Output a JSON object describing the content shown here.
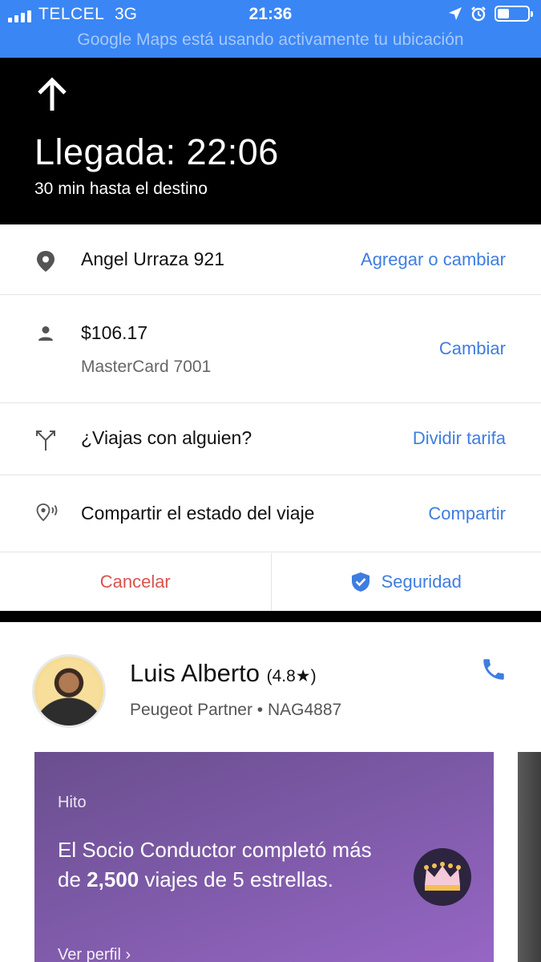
{
  "status_bar": {
    "carrier": "TELCEL",
    "network": "3G",
    "time": "21:36",
    "battery_level": 0.3,
    "banner": "Google Maps está usando activamente tu ubicación",
    "icons": [
      "location-arrow-icon",
      "alarm-icon",
      "battery-icon"
    ],
    "accent_color": "#3a86f5"
  },
  "navigation": {
    "direction_icon": "arrow-up-icon",
    "arrival": "Llegada: 22:06",
    "eta": "30 min hasta el destino"
  },
  "trip_rows": {
    "destination": {
      "icon": "map-pin-icon",
      "text": "Angel Urraza 921",
      "action": "Agregar o cambiar"
    },
    "payment": {
      "icon": "person-icon",
      "amount": "$106.17",
      "method": "MasterCard 7001",
      "action": "Cambiar"
    },
    "split": {
      "icon": "split-icon",
      "text": "¿Viajas con alguien?",
      "action": "Dividir tarifa"
    },
    "share": {
      "icon": "share-location-icon",
      "text": "Compartir el estado del viaje",
      "action": "Compartir"
    }
  },
  "bottom_actions": {
    "cancel": "Cancelar",
    "security": "Seguridad",
    "security_icon": "shield-check-icon"
  },
  "driver": {
    "name": "Luis Alberto",
    "rating": "(4.8★)",
    "vehicle": "Peugeot Partner • NAG4887",
    "phone_icon": "phone-icon"
  },
  "milestone": {
    "label": "Hito",
    "text_before": "El Socio Conductor completó más de ",
    "highlight": "2,500",
    "text_after": " viajes de 5 estrellas.",
    "link": "Ver perfil ›",
    "badge_icon": "crown-icon"
  },
  "colors": {
    "link_blue": "#3f7de0",
    "cancel_red": "#d9534f",
    "milestone_purple": "#7c59a6"
  }
}
